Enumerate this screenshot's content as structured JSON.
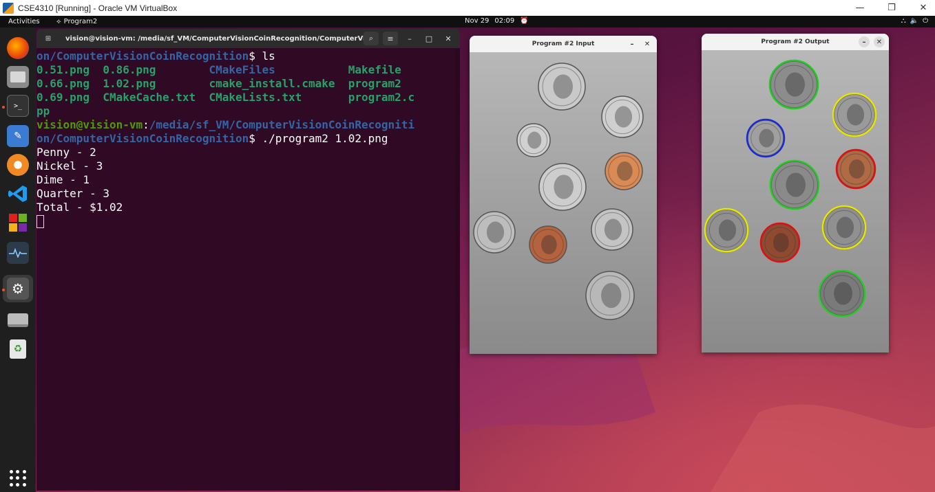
{
  "vbox": {
    "title": "CSE4310 [Running] - Oracle VM VirtualBox",
    "controls": {
      "minimize": "—",
      "restore": "❐",
      "close": "✕"
    }
  },
  "topbar": {
    "activities": "Activities",
    "app_name": "Program2",
    "date": "Nov 29",
    "time": "02:09",
    "tray": {
      "network": "⛬",
      "volume": "🔈",
      "power": "⏻"
    }
  },
  "dock": {
    "items": [
      "firefox",
      "files",
      "terminal",
      "text-editor",
      "ubuntu-software",
      "vscode",
      "app-center",
      "system-monitor",
      "settings",
      "drive",
      "trash"
    ]
  },
  "terminal": {
    "title": "vision@vision-vm: /media/sf_VM/ComputerVisionCoinRecognition/ComputerVis...",
    "lines": [
      {
        "segments": [
          {
            "text": "on/ComputerVisionCoinRecognition",
            "cls": "c-blue"
          },
          {
            "text": "$ ls",
            "cls": "c-white"
          }
        ]
      },
      {
        "segments": [
          {
            "text": "0.51.png  0.86.png        ",
            "cls": "c-teal"
          },
          {
            "text": "CMakeFiles",
            "cls": "c-blue"
          },
          {
            "text": "           ",
            "cls": "c-white"
          },
          {
            "text": "Makefile",
            "cls": "c-teal"
          }
        ]
      },
      {
        "segments": [
          {
            "text": "0.66.png  1.02.png        cmake_install.cmake  program2",
            "cls": "c-teal"
          }
        ]
      },
      {
        "segments": [
          {
            "text": "0.69.png  CMakeCache.txt  CMakeLists.txt       program2.c",
            "cls": "c-teal"
          }
        ]
      },
      {
        "segments": [
          {
            "text": "pp",
            "cls": "c-teal"
          }
        ]
      },
      {
        "segments": [
          {
            "text": "vision@vision-vm",
            "cls": "c-green"
          },
          {
            "text": ":",
            "cls": "c-white"
          },
          {
            "text": "/media/sf_VM/ComputerVisionCoinRecogniti",
            "cls": "c-blue"
          }
        ]
      },
      {
        "segments": [
          {
            "text": "on/ComputerVisionCoinRecognition",
            "cls": "c-blue"
          },
          {
            "text": "$ ./program2 1.02.png",
            "cls": "c-white"
          }
        ]
      },
      {
        "segments": [
          {
            "text": "Penny - 2",
            "cls": "c-white"
          }
        ]
      },
      {
        "segments": [
          {
            "text": "Nickel - 3",
            "cls": "c-white"
          }
        ]
      },
      {
        "segments": [
          {
            "text": "Dime - 1",
            "cls": "c-white"
          }
        ]
      },
      {
        "segments": [
          {
            "text": "Quarter - 3",
            "cls": "c-white"
          }
        ]
      },
      {
        "segments": [
          {
            "text": "Total - $1.02",
            "cls": "c-white"
          }
        ]
      }
    ]
  },
  "input_window": {
    "title": "Program #2 Input",
    "coins": [
      {
        "type": "quarter",
        "fill": "#c9c9c9"
      },
      {
        "type": "nickel",
        "fill": "#cfcfcf"
      },
      {
        "type": "dime",
        "fill": "#d0d0d0"
      },
      {
        "type": "penny",
        "fill": "#d98a55"
      },
      {
        "type": "nickel",
        "fill": "#cdcdcd"
      },
      {
        "type": "quarter",
        "fill": "#bdbdbd"
      },
      {
        "type": "penny",
        "fill": "#b4633e"
      },
      {
        "type": "nickel",
        "fill": "#c4c4c4"
      },
      {
        "type": "quarter",
        "fill": "#b8b8b8"
      }
    ]
  },
  "output_window": {
    "title": "Program #2 Output",
    "coins": [
      {
        "type": "quarter",
        "ring": "#22cc22"
      },
      {
        "type": "nickel",
        "ring": "#e6e600"
      },
      {
        "type": "dime",
        "ring": "#1a2cd6"
      },
      {
        "type": "penny",
        "ring": "#e01010"
      },
      {
        "type": "quarter",
        "ring": "#22cc22"
      },
      {
        "type": "nickel",
        "ring": "#e6e600"
      },
      {
        "type": "penny",
        "ring": "#e01010"
      },
      {
        "type": "nickel",
        "ring": "#e6e600"
      },
      {
        "type": "quarter",
        "ring": "#22cc22"
      }
    ]
  }
}
